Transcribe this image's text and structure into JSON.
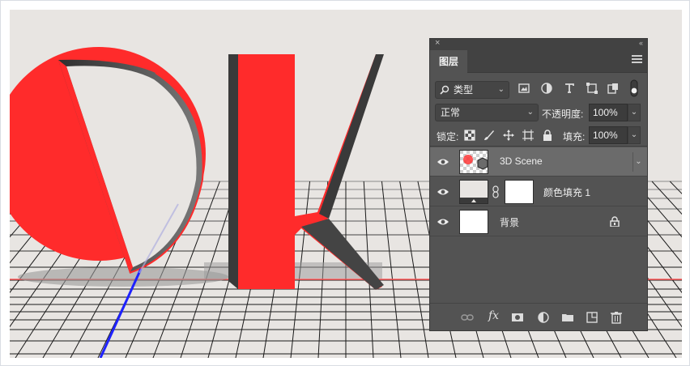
{
  "colors": {
    "page_bg": "#ffffff",
    "canvas_bg": "#e8e5e2",
    "letter_red": "#ff2b2b",
    "letter_dark": "#3a3a3a",
    "grid_line": "#1a1a1a",
    "axis_blue": "#1e22ff",
    "panel_bg": "#535353",
    "panel_header_bg": "#424242",
    "selected_layer_bg": "#6b6b6b"
  },
  "canvas": {
    "letters": [
      "D",
      "K"
    ]
  },
  "layers_panel": {
    "close_label": "×",
    "collapse_label": "‹‹",
    "tab_label": "图层",
    "menu_icon": "hamburger-menu-icon",
    "filter": {
      "search_icon": "search-icon",
      "kind_label": "类型",
      "icons": [
        "image-filter-icon",
        "adjustment-filter-icon",
        "text-filter-icon",
        "shape-filter-icon",
        "smart-object-filter-icon",
        "filter-toggle-icon"
      ]
    },
    "blend": {
      "mode": "正常",
      "opacity_label": "不透明度:",
      "opacity_value": "100%"
    },
    "lock": {
      "label": "锁定:",
      "icons": [
        "lock-transparent-pixels-icon",
        "lock-image-pixels-icon",
        "lock-position-icon",
        "lock-artboard-icon",
        "lock-all-icon"
      ],
      "fill_label": "填充:",
      "fill_value": "100%"
    },
    "layers": [
      {
        "name": "3D Scene",
        "selected": true,
        "thumb": "3d-scene-thumbnail",
        "expand": "›"
      },
      {
        "name": "颜色填充 1",
        "selected": false,
        "thumb": "color-fill-thumbnail"
      },
      {
        "name": "背景",
        "selected": false,
        "thumb": "background-thumbnail"
      }
    ],
    "footer": {
      "icons": [
        "link-layers-icon",
        "fx-icon",
        "add-mask-icon",
        "new-adjustment-icon",
        "new-group-icon",
        "new-layer-icon",
        "delete-layer-icon"
      ],
      "fx_label": "fx"
    }
  }
}
